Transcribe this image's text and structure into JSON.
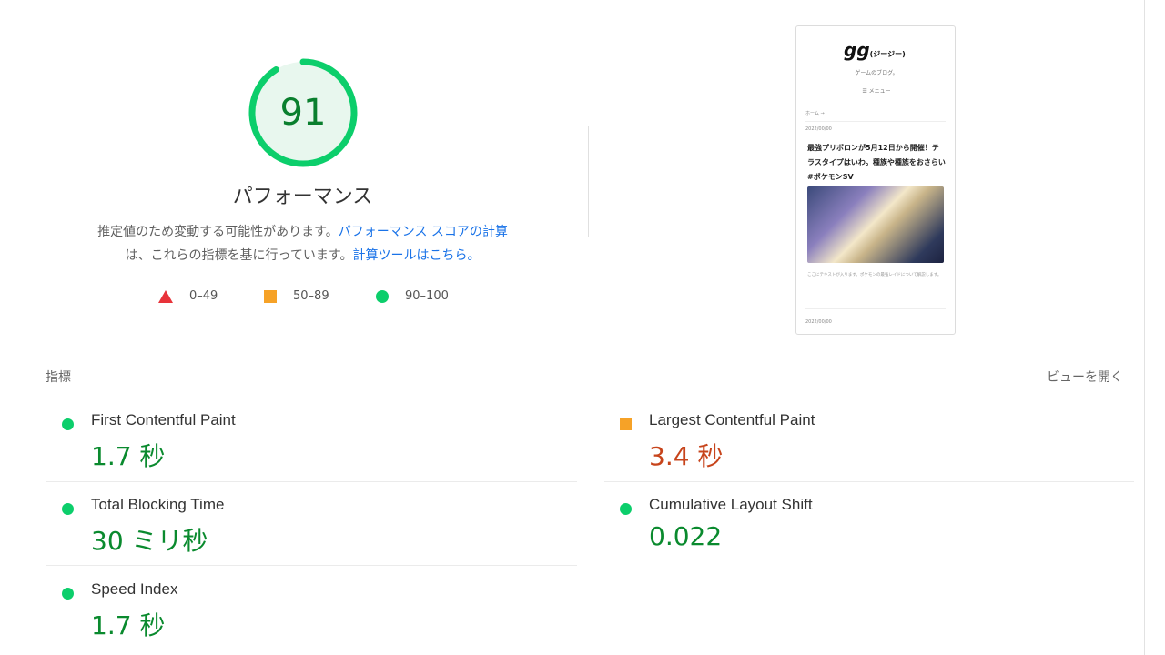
{
  "category": {
    "score": "91",
    "score_fraction": 0.91,
    "title": "パフォーマンス",
    "description_prefix": "推定値のため変動する可能性があります。",
    "description_link1": "パフォーマンス スコアの計算",
    "description_mid": "は、これらの指標を基に行っています。",
    "description_link2": "計算ツールはこちら。"
  },
  "legend": [
    {
      "label": "0–49",
      "icon": "triangle-fail-icon"
    },
    {
      "label": "50–89",
      "icon": "square-average-icon"
    },
    {
      "label": "90–100",
      "icon": "circle-pass-icon"
    }
  ],
  "screenshot": {
    "logo": "gg",
    "logo_sub": "(ジージー)",
    "tagline": "ゲームのブログ。",
    "menu": "☰ メニュー",
    "breadcrumb": "ホーム →",
    "date_top": "2022/00/00",
    "headline": "最強プリボロンが5月12日から開催！テラスタイプはいわ。種族や種族をおさらい #ポケモンSV",
    "excerpt": "ここにテキストが入ります。ポケモンの最強レイドについて解説します。",
    "date_bottom": "2022/00/00"
  },
  "metrics_header": {
    "label": "指標",
    "toggle": "ビューを開く"
  },
  "metrics": [
    {
      "name": "First Contentful Paint",
      "value": "1.7 秒",
      "rating": "pass"
    },
    {
      "name": "Largest Contentful Paint",
      "value": "3.4 秒",
      "rating": "average"
    },
    {
      "name": "Total Blocking Time",
      "value": "30 ミリ秒",
      "rating": "pass"
    },
    {
      "name": "Cumulative Layout Shift",
      "value": "0.022",
      "rating": "pass"
    },
    {
      "name": "Speed Index",
      "value": "1.7 秒",
      "rating": "pass"
    }
  ],
  "colors": {
    "pass": "#0cce6b",
    "average": "#f6a227",
    "fail": "#e8333a",
    "pass_text": "#0a8a2e",
    "average_text": "#c7441b",
    "gauge_bg": "#e8f7ee",
    "link": "#1a73e8"
  }
}
